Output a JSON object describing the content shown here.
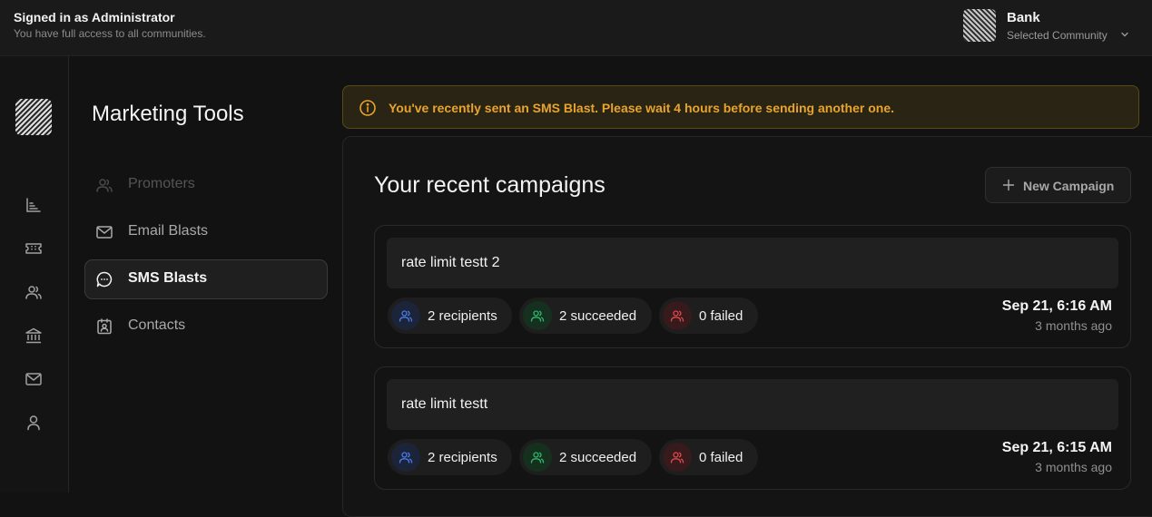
{
  "header": {
    "signed_in_title": "Signed in as Administrator",
    "signed_in_sub": "You have full access to all communities.",
    "community_name": "Bank",
    "community_label": "Selected Community"
  },
  "rail": {
    "icons": [
      "chart-icon",
      "ticket-icon",
      "users-icon",
      "bank-icon",
      "mail-icon",
      "user-icon"
    ]
  },
  "subnav": {
    "title": "Marketing Tools",
    "items": [
      {
        "label": "Promoters",
        "icon": "users-icon",
        "state": "disabled"
      },
      {
        "label": "Email Blasts",
        "icon": "mail-icon",
        "state": "normal"
      },
      {
        "label": "SMS Blasts",
        "icon": "chat-icon",
        "state": "active"
      },
      {
        "label": "Contacts",
        "icon": "contact-card-icon",
        "state": "normal"
      }
    ]
  },
  "alert": {
    "text": "You've recently sent an SMS Blast. Please wait 4 hours before sending another one.",
    "color": "#e8a42c"
  },
  "campaigns": {
    "title": "Your recent campaigns",
    "new_button": "New Campaign",
    "items": [
      {
        "name": "rate limit testt 2",
        "recipients": "2 recipients",
        "succeeded": "2 succeeded",
        "failed": "0 failed",
        "date": "Sep 21, 6:16 AM",
        "ago": "3 months ago"
      },
      {
        "name": "rate limit testt",
        "recipients": "2 recipients",
        "succeeded": "2 succeeded",
        "failed": "0 failed",
        "date": "Sep 21, 6:15 AM",
        "ago": "3 months ago"
      }
    ]
  },
  "colors": {
    "recipients": "#4b7bec",
    "succeeded": "#2fb86a",
    "failed": "#e0474c",
    "disabled_text": "#5a5a5a",
    "normal_text": "#a9a9a9"
  }
}
